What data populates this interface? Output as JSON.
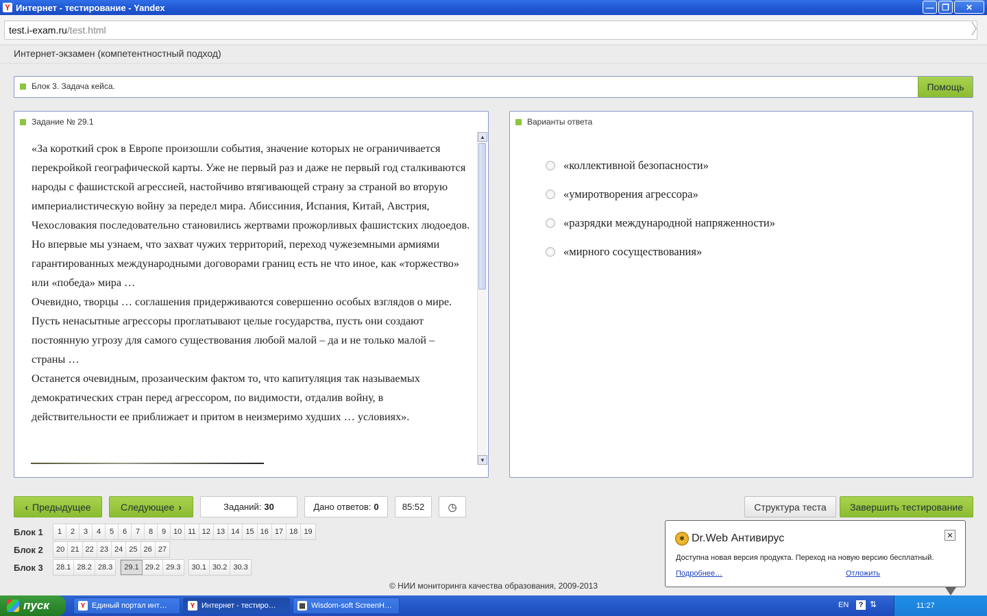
{
  "window": {
    "title": "Интернет - тестирование - Yandex",
    "logo": "Y",
    "minimize": "—",
    "restore": "❐",
    "close": "✕"
  },
  "address": {
    "host": "test.i-exam.ru",
    "path": "/test.html"
  },
  "exam_title": "Интернет-экзамен (компетентностный подход)",
  "block_header": {
    "label": "Блок 3. Задача кейса.",
    "help": "Помощь"
  },
  "task": {
    "header": "Задание № 29.1",
    "paragraphs": [
      "«За короткий срок в Европе произошли события, значение которых не ограничивается перекройкой географической карты. Уже не первый раз и даже не первый год сталкиваются народы с фашистской агрессией, настойчиво втягивающей страну за страной во вторую империалистическую войну за передел мира. Абиссиния, Испания, Китай, Австрия, Чехословакия последовательно становились жертвами прожорливых фашистских людоедов. Но впервые мы узнаем, что захват чужих территорий, переход чужеземными армиями гарантированных международными договорами границ есть не что иное, как «торжество» или «победа» мира …",
      "Очевидно, творцы … соглашения придерживаются совершенно особых взглядов о мире. Пусть ненасытные агрессоры проглатывают целые государства, пусть они создают постоянную угрозу для самого существования любой малой – да и не только малой – страны …",
      "Останется очевидным, прозаическим фактом то, что капитуляция так называемых демократических стран перед агрессором, по видимости, отдалив войну, в действительности ее приближает и притом в неизмеримо худших … условиях»."
    ]
  },
  "answers": {
    "header": "Варианты ответа",
    "options": [
      "«коллективной безопасности»",
      "«умиротворения агрессора»",
      "«разрядки международной напряженности»",
      "«мирного сосуществования»"
    ]
  },
  "controls": {
    "prev": "Предыдущее",
    "next": "Следующее",
    "tasks_label": "Заданий:",
    "tasks_count": "30",
    "answered_label": "Дано ответов:",
    "answered_count": "0",
    "timer": "85:52",
    "structure": "Структура теста",
    "finish": "Завершить тестирование"
  },
  "blocks": [
    {
      "label": "Блок 1",
      "groups": [
        [
          "1",
          "2",
          "3",
          "4",
          "5",
          "6",
          "7",
          "8",
          "9",
          "10",
          "11",
          "12",
          "13",
          "14",
          "15",
          "16",
          "17",
          "18",
          "19"
        ]
      ]
    },
    {
      "label": "Блок 2",
      "groups": [
        [
          "20",
          "21",
          "22",
          "23",
          "24",
          "25",
          "26",
          "27"
        ]
      ]
    },
    {
      "label": "Блок 3",
      "groups": [
        [
          "28.1",
          "28.2",
          "28.3"
        ],
        [
          "29.1",
          "29.2",
          "29.3"
        ],
        [
          "30.1",
          "30.2",
          "30.3"
        ]
      ],
      "active": "29.1"
    }
  ],
  "footer": "© НИИ мониторинга качества образования, 2009-2013",
  "popup": {
    "title": "Dr.Web Антивирус",
    "message": "Доступна новая версия продукта. Переход на новую версию бесплатный.",
    "more": "Подробнее…",
    "later": "Отложить"
  },
  "taskbar": {
    "start": "пуск",
    "tasks": [
      "Единый портал инт…",
      "Интернет - тестиро…",
      "Wisdom-soft ScreenH…"
    ],
    "lang": "EN",
    "time": "11:27"
  }
}
